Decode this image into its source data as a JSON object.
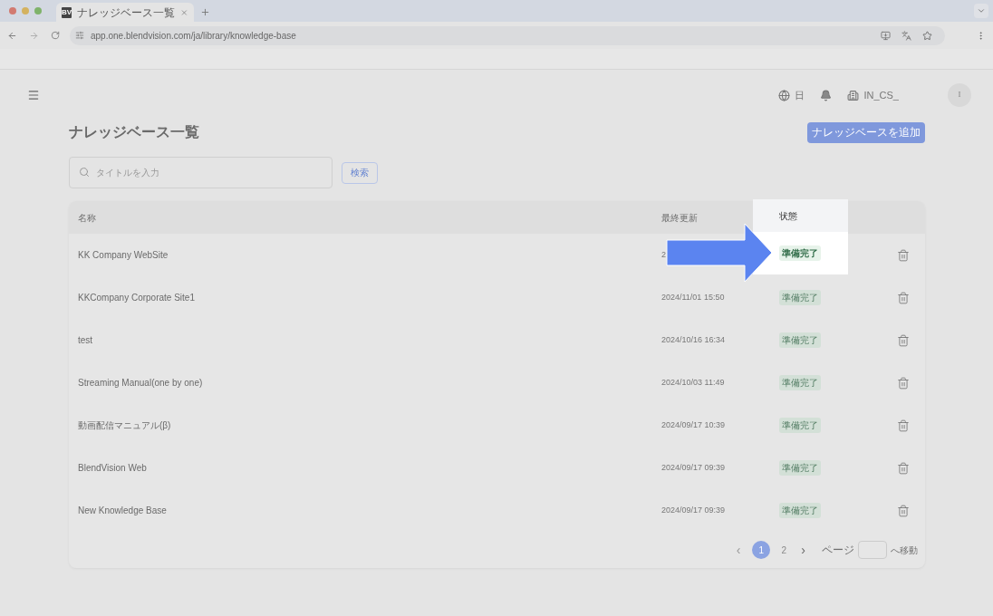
{
  "browser": {
    "tab_title": "ナレッジベース一覧",
    "tab_icon": "BV",
    "url": "app.one.blendvision.com/ja/library/knowledge-base"
  },
  "header": {
    "language": "日",
    "org": "IN_CS_",
    "avatar": "I"
  },
  "page_title": "ナレッジベース一覧",
  "add_button": "ナレッジベースを追加",
  "search": {
    "placeholder": "タイトルを入力",
    "button": "検索"
  },
  "table": {
    "columns": [
      {
        "label": "名称",
        "highlighted": false
      },
      {
        "label": "最終更新",
        "highlighted": false
      },
      {
        "label": "状態",
        "highlighted": true
      }
    ],
    "rows": [
      {
        "name": "KK Company WebSite",
        "updated": "2",
        "status": "準備完了",
        "highlighted": true
      },
      {
        "name": "KKCompany Corporate Site1",
        "updated": "2024/11/01 15:50",
        "status": "準備完了",
        "highlighted": false
      },
      {
        "name": "test",
        "updated": "2024/10/16 16:34",
        "status": "準備完了",
        "highlighted": false
      },
      {
        "name": "Streaming Manual(one by one)",
        "updated": "2024/10/03 11:49",
        "status": "準備完了",
        "highlighted": false
      },
      {
        "name": "動画配信マニュアル(β)",
        "updated": "2024/09/17 10:39",
        "status": "準備完了",
        "highlighted": false
      },
      {
        "name": "BlendVision Web",
        "updated": "2024/09/17 09:39",
        "status": "準備完了",
        "highlighted": false
      },
      {
        "name": "New Knowledge Base",
        "updated": "2024/09/17 09:39",
        "status": "準備完了",
        "highlighted": false
      }
    ]
  },
  "pagination": {
    "prev": "‹",
    "pages": [
      {
        "label": "1",
        "selected": true
      },
      {
        "label": "2",
        "selected": false
      }
    ],
    "next": "›",
    "page_label": "ページ",
    "go_label": "へ移動"
  }
}
